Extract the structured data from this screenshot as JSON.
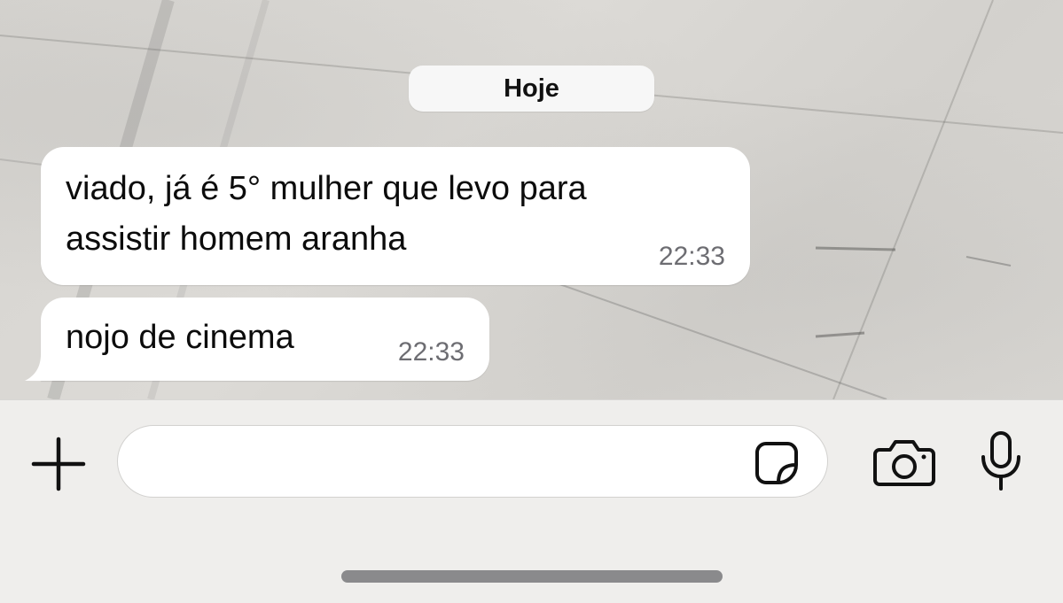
{
  "chat": {
    "date_separator": "Hoje",
    "messages": [
      {
        "text": "viado, já é 5° mulher que levo para\nassistir homem aranha",
        "time": "22:33"
      },
      {
        "text": "nojo de cinema",
        "time": "22:33"
      }
    ]
  },
  "composer": {
    "input_value": "",
    "input_placeholder": "",
    "icons": {
      "attach": "plus-icon",
      "sticker": "sticker-icon",
      "camera": "camera-icon",
      "mic": "microphone-icon"
    }
  },
  "colors": {
    "bubble_background": "#ffffff",
    "timestamp": "#6d6d72",
    "composer_background": "#efeeec"
  }
}
